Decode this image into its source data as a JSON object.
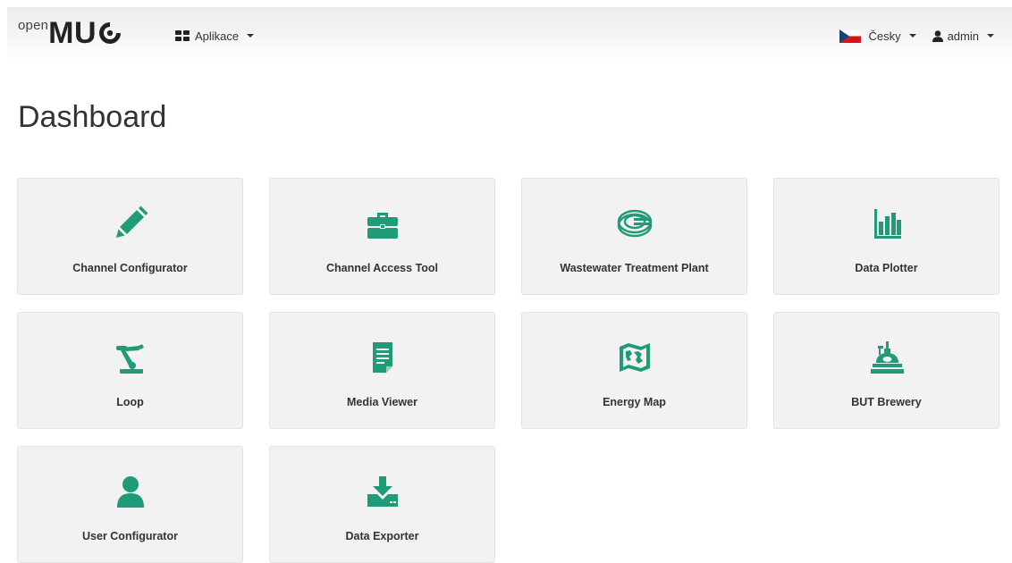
{
  "navbar": {
    "brand_small": "open",
    "brand_big": "MU",
    "apps_label": "Aplikace",
    "language_label": "Česky",
    "user_label": "admin"
  },
  "page": {
    "title": "Dashboard"
  },
  "colors": {
    "accent": "#1f9c77",
    "tile_background": "#f2f2f2"
  },
  "apps": [
    {
      "label": "Channel Configurator",
      "icon": "pencil-icon"
    },
    {
      "label": "Channel Access Tool",
      "icon": "briefcase-icon"
    },
    {
      "label": "Wastewater Treatment Plant",
      "icon": "wastewater-plant-icon"
    },
    {
      "label": "Data Plotter",
      "icon": "bar-chart-icon"
    },
    {
      "label": "Loop",
      "icon": "robot-arm-icon"
    },
    {
      "label": "Media Viewer",
      "icon": "document-icon"
    },
    {
      "label": "Energy Map",
      "icon": "map-icon"
    },
    {
      "label": "BUT Brewery",
      "icon": "brewery-icon"
    },
    {
      "label": "User Configurator",
      "icon": "user-icon"
    },
    {
      "label": "Data Exporter",
      "icon": "download-icon"
    }
  ]
}
